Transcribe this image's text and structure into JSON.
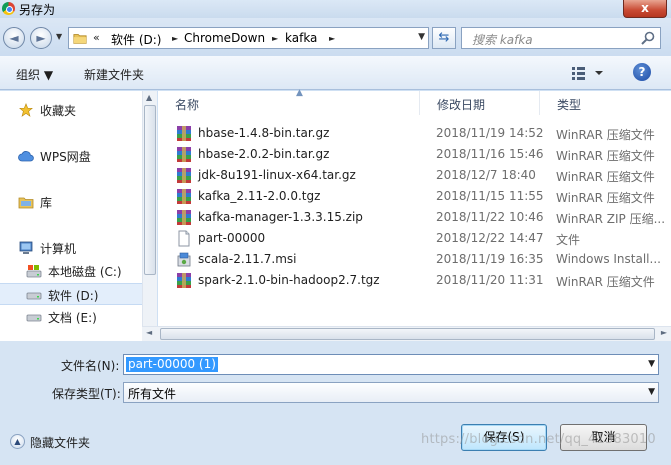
{
  "window": {
    "title": "另存为",
    "close_label": "x"
  },
  "nav": {
    "back": "◄",
    "forward": "►"
  },
  "address": {
    "crumb_prefix": "«",
    "crumbs": [
      "软件 (D:)",
      "ChromeDown",
      "kafka"
    ],
    "separator": "►"
  },
  "search": {
    "placeholder": "搜索 kafka"
  },
  "toolbar": {
    "organize": "组织 ▼",
    "new_folder": "新建文件夹",
    "help": "?"
  },
  "sidebar": {
    "items": [
      {
        "label": "收藏夹",
        "icon": "star-icon"
      },
      {
        "label": "WPS网盘",
        "icon": "cloud-icon"
      },
      {
        "label": "库",
        "icon": "library-icon"
      },
      {
        "label": "计算机",
        "icon": "computer-icon"
      },
      {
        "label": "本地磁盘 (C:)",
        "icon": "system-drive-icon"
      },
      {
        "label": "软件 (D:)",
        "icon": "drive-icon",
        "selected": true
      },
      {
        "label": "文档 (E:)",
        "icon": "drive-icon"
      }
    ]
  },
  "columns": {
    "name": "名称",
    "modified": "修改日期",
    "type": "类型"
  },
  "files": [
    {
      "name": "hbase-1.4.8-bin.tar.gz",
      "date": "2018/11/19 14:52",
      "type": "WinRAR 压缩文件",
      "icon": "winrar-icon"
    },
    {
      "name": "hbase-2.0.2-bin.tar.gz",
      "date": "2018/11/16 15:46",
      "type": "WinRAR 压缩文件",
      "icon": "winrar-icon"
    },
    {
      "name": "jdk-8u191-linux-x64.tar.gz",
      "date": "2018/12/7 18:40",
      "type": "WinRAR 压缩文件",
      "icon": "winrar-icon"
    },
    {
      "name": "kafka_2.11-2.0.0.tgz",
      "date": "2018/11/15 11:55",
      "type": "WinRAR 压缩文件",
      "icon": "winrar-icon"
    },
    {
      "name": "kafka-manager-1.3.3.15.zip",
      "date": "2018/11/22 10:46",
      "type": "WinRAR ZIP 压缩...",
      "icon": "winrar-icon"
    },
    {
      "name": "part-00000",
      "date": "2018/12/22 14:47",
      "type": "文件",
      "icon": "blank-file-icon"
    },
    {
      "name": "scala-2.11.7.msi",
      "date": "2018/11/19 16:35",
      "type": "Windows Install...",
      "icon": "installer-icon"
    },
    {
      "name": "spark-2.1.0-bin-hadoop2.7.tgz",
      "date": "2018/11/20 11:31",
      "type": "WinRAR 压缩文件",
      "icon": "winrar-icon"
    }
  ],
  "form": {
    "filename_label": "文件名(N):",
    "filename_value": "part-00000 (1)",
    "filetype_label": "保存类型(T):",
    "filetype_value": "所有文件",
    "hide_folders": "隐藏文件夹",
    "save": "保存(S)",
    "cancel": "取消"
  },
  "watermark": "https://blog.csdn.net/qq_41383010"
}
